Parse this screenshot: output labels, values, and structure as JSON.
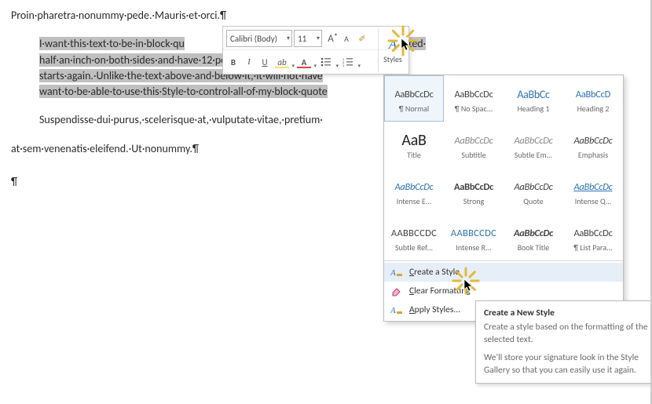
{
  "doc": {
    "p1": "Proin·pharetra·nonummy·pede.·Mauris·et·orci.¶",
    "bq_l1": "I·want·this·text·to·be·in·block·qu",
    "bq_l1b": "ed·and·indented·",
    "bq_l2": "half·an·inch·on·both·sides·and·have·12·points·of·space·beneath·",
    "bq_l3": "starts·again.·Unlike·the·text·above·and·below·it,·it·will·not·have",
    "bq_l4": "want·to·be·able·to·use·this·Style·to·control·all·of·my·block·quote",
    "p2": "Suspendisse·dui·purus,·scelerisque·at,·vulputate·vitae,·pretium·",
    "p3": "at·sem·venenatis·eleifend.·Ut·nonummy.¶",
    "p4": "¶"
  },
  "mini": {
    "font": "Calibri (Body)",
    "size": "11",
    "growA": "A",
    "shrinkA": "A",
    "brush": "✐",
    "bold": "B",
    "italic": "I",
    "underline": "U",
    "styles_icon": "A",
    "styles_label": "Styles"
  },
  "styles": {
    "tiles": [
      {
        "sample": "AaBbCcDc",
        "label": "¶ Normal",
        "sel": true
      },
      {
        "sample": "AaBbCcDc",
        "label": "¶ No Spac..."
      },
      {
        "sample": "AaBbCc",
        "label": "Heading 1",
        "cls": "blue",
        "sz": "14px"
      },
      {
        "sample": "AaBbCcD",
        "label": "Heading 2",
        "cls": "blue",
        "sz": "12.5px"
      },
      {
        "sample": "AaB",
        "label": "Title",
        "cls": "big"
      },
      {
        "sample": "AaBbCcDc",
        "label": "Subtitle",
        "cls": "gray"
      },
      {
        "sample": "AaBbCcDc",
        "label": "Subtle Em...",
        "cls": "gray ital"
      },
      {
        "sample": "AaBbCcDc",
        "label": "Emphasis",
        "cls": "ital"
      },
      {
        "sample": "AaBbCcDc",
        "label": "Intense E...",
        "cls": "blue ital"
      },
      {
        "sample": "AaBbCcDc",
        "label": "Strong",
        "cls": "bold"
      },
      {
        "sample": "AaBbCcDc",
        "label": "Quote",
        "cls": "ital"
      },
      {
        "sample": "AaBbCcDc",
        "label": "Intense Q...",
        "cls": "blue ital ul"
      },
      {
        "sample": "AABBCCDC",
        "label": "Subtle Ref...",
        "cls": "caps"
      },
      {
        "sample": "AABBCCDC",
        "label": "Intense R...",
        "cls": "blue caps"
      },
      {
        "sample": "AaBbCcDc",
        "label": "Book Title",
        "cls": "bold ital"
      },
      {
        "sample": "AaBbCcDc",
        "label": "¶ List Para..."
      }
    ],
    "create_a": "C",
    "create_rest": "reate a Style",
    "clear_a": "C",
    "clear_rest": "lear Formatting",
    "apply_a": "A",
    "apply_rest": "pply Styles..."
  },
  "tip": {
    "h": "Create a New Style",
    "p1": "Create a style based on the formatting of the selected text.",
    "p2": "We'll store your signature look in the Style Gallery so that you can easily use it again."
  }
}
